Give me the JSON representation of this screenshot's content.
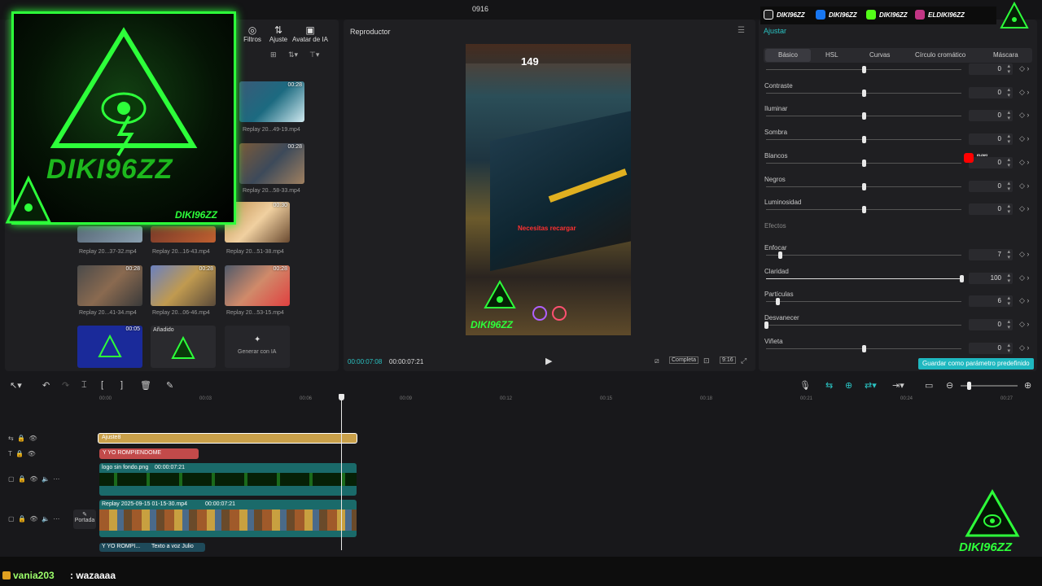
{
  "window": {
    "title": "0916"
  },
  "media_panel": {
    "tools": [
      "Filtros",
      "Ajuste",
      "Avatar de IA"
    ],
    "items": [
      {
        "caption": "Replay 20...49-19.mp4",
        "duration": "00:28"
      },
      {
        "caption": "Replay 20...58-33.mp4",
        "duration": "00:28"
      },
      {
        "caption": "Replay 20...37-32.mp4",
        "duration": ""
      },
      {
        "caption": "Replay 20...16-43.mp4",
        "duration": ""
      },
      {
        "caption": "Replay 20...51-38.mp4",
        "duration": "00:30"
      },
      {
        "caption": "Replay 20...41-34.mp4",
        "duration": "00:28"
      },
      {
        "caption": "Replay 20...06-46.mp4",
        "duration": "00:28"
      },
      {
        "caption": "Replay 20...53-15.mp4",
        "duration": "00:28"
      },
      {
        "caption": "",
        "duration": "00:05"
      },
      {
        "caption": "",
        "duration": ""
      }
    ],
    "added_badge": "Añadido",
    "generate_ai": "Generar con IA"
  },
  "player": {
    "title": "Reproductor",
    "current_time": "00:00:07:08",
    "total_time": "00:00:07:21",
    "ratio_button": "Completa",
    "aspect": "9:16",
    "hud_warning": "Necesitas recargar",
    "overlay_text": "DIKI96ZZ"
  },
  "adjust": {
    "tab": "Ajustar",
    "subtabs": [
      "Básico",
      "HSL",
      "Curvas",
      "Círculo cromático",
      "Máscara"
    ],
    "params": [
      {
        "label": "",
        "value": "0",
        "level": 0.5
      },
      {
        "label": "Contraste",
        "value": "0",
        "level": 0.5
      },
      {
        "label": "Iluminar",
        "value": "0",
        "level": 0.5
      },
      {
        "label": "Sombra",
        "value": "0",
        "level": 0.5
      },
      {
        "label": "Blancos",
        "value": "0",
        "level": 0.5
      },
      {
        "label": "Negros",
        "value": "0",
        "level": 0.5
      },
      {
        "label": "Luminosidad",
        "value": "0",
        "level": 0.5
      }
    ],
    "effects_header": "Efectos",
    "effects": [
      {
        "label": "Enfocar",
        "value": "7",
        "level": 0.07
      },
      {
        "label": "Claridad",
        "value": "100",
        "level": 1.0
      },
      {
        "label": "Partículas",
        "value": "6",
        "level": 0.06
      },
      {
        "label": "Desvanecer",
        "value": "0",
        "level": 0.0
      },
      {
        "label": "Viñeta",
        "value": "0",
        "level": 0.5
      }
    ],
    "save_default": "Guardar como parámetro predefinido"
  },
  "timeline": {
    "ticks": [
      "00:00",
      "00:03",
      "00:06",
      "00:09",
      "00:12",
      "00:15",
      "00:18",
      "00:21",
      "00:24",
      "00:27"
    ],
    "clips": {
      "adjust": "Ajuste8",
      "text": "Y YO ROMPIENDOME",
      "logo": {
        "name": "logo sin fondo.png",
        "duration": "00:00:07:21"
      },
      "video": {
        "name": "Replay 2025-09-15 01-15-30.mp4",
        "duration": "00:00:07:21"
      },
      "tts": {
        "name": "Y YO ROMPI...",
        "label": "Texto a voz Julio"
      }
    },
    "cover": "Portada"
  },
  "overlay": {
    "logo_text": "DIKI96ZZ",
    "logo_sub": "DIKI96ZZ",
    "socials": [
      "DIKI96ZZ",
      "DIKI96ZZ",
      "DIKI96ZZ",
      "ELDIKI96ZZ",
      "ELDIKI"
    ],
    "corner_logo": "DIKI96ZZ"
  },
  "chat": {
    "user": "vania203",
    "message": ": wazaaaa"
  }
}
